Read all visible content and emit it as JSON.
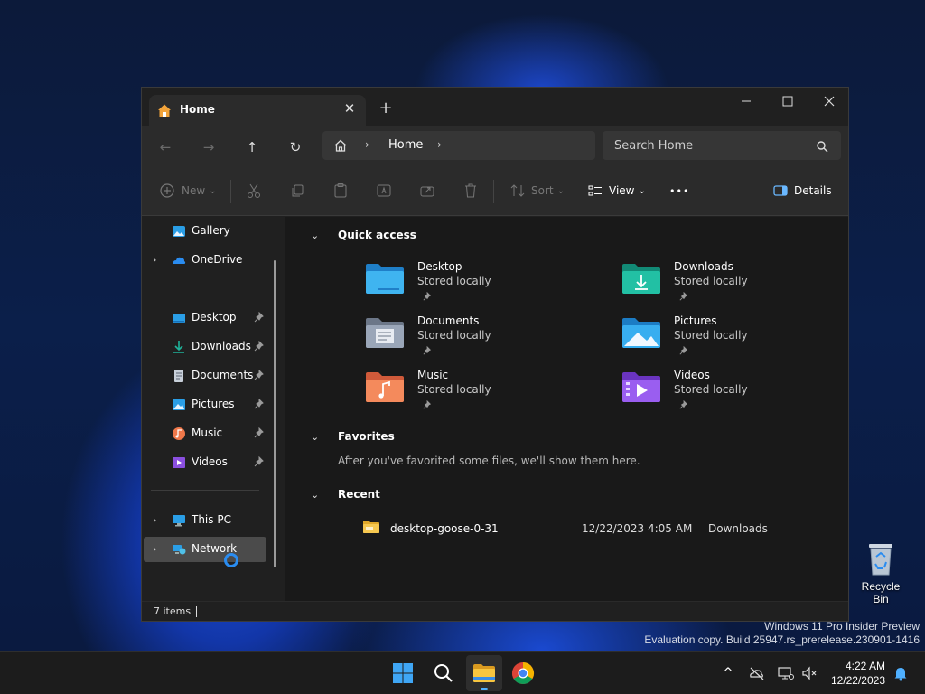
{
  "window": {
    "tab_title": "Home",
    "tab_close": "✕",
    "new_tab": "+",
    "controls": {
      "minimize": "—",
      "maximize": "☐",
      "close": "✕"
    }
  },
  "nav": {
    "back": "←",
    "forward": "→",
    "up": "↑",
    "refresh": "↻",
    "breadcrumb": "Home",
    "chevron": "›",
    "search_placeholder": "Search Home"
  },
  "toolbar": {
    "new_label": "New",
    "sort_label": "Sort",
    "view_label": "View",
    "more_label": "•••",
    "details_label": "Details",
    "dropdown": "⌄"
  },
  "sidebar": {
    "top_items": [
      {
        "label": "Gallery",
        "icon": "gallery-icon"
      },
      {
        "label": "OneDrive",
        "icon": "onedrive-icon"
      }
    ],
    "pinned": [
      {
        "label": "Desktop",
        "icon": "desktop-folder-icon"
      },
      {
        "label": "Downloads",
        "icon": "downloads-icon"
      },
      {
        "label": "Documents",
        "icon": "documents-icon"
      },
      {
        "label": "Pictures",
        "icon": "pictures-icon"
      },
      {
        "label": "Music",
        "icon": "music-icon"
      },
      {
        "label": "Videos",
        "icon": "videos-icon"
      }
    ],
    "bottom_items": [
      {
        "label": "This PC",
        "icon": "this-pc-icon"
      },
      {
        "label": "Network",
        "icon": "network-icon",
        "selected": true
      }
    ],
    "chevron": "›"
  },
  "main": {
    "quick_access_title": "Quick access",
    "quick_access": [
      {
        "name": "Desktop",
        "sub": "Stored locally",
        "color": "#2aa0e8"
      },
      {
        "name": "Downloads",
        "sub": "Stored locally",
        "color": "#1fb39a"
      },
      {
        "name": "Documents",
        "sub": "Stored locally",
        "color": "#8a98ad"
      },
      {
        "name": "Pictures",
        "sub": "Stored locally",
        "color": "#2a9ee6"
      },
      {
        "name": "Music",
        "sub": "Stored locally",
        "color": "#f0784a"
      },
      {
        "name": "Videos",
        "sub": "Stored locally",
        "color": "#8a4fe0"
      }
    ],
    "favorites_title": "Favorites",
    "favorites_empty": "After you've favorited some files, we'll show them here.",
    "recent_title": "Recent",
    "recent": [
      {
        "name": "desktop-goose-0-31",
        "date": "12/22/2023 4:05 AM",
        "location": "Downloads"
      }
    ],
    "section_chevron": "⌄"
  },
  "status": {
    "items": "7 items"
  },
  "desktop": {
    "recycle_bin": "Recycle Bin",
    "watermark_line1": "Windows 11 Pro Insider Preview",
    "watermark_line2": "Evaluation copy. Build 25947.rs_prerelease.230901-1416"
  },
  "taskbar": {
    "time": "4:22 AM",
    "date": "12/22/2023",
    "tray_chevron": "^"
  },
  "colors": {
    "accent": "#4fb0ff",
    "window_bg": "#202020",
    "panel_bg": "#2b2b2b",
    "content_bg": "#191919"
  }
}
